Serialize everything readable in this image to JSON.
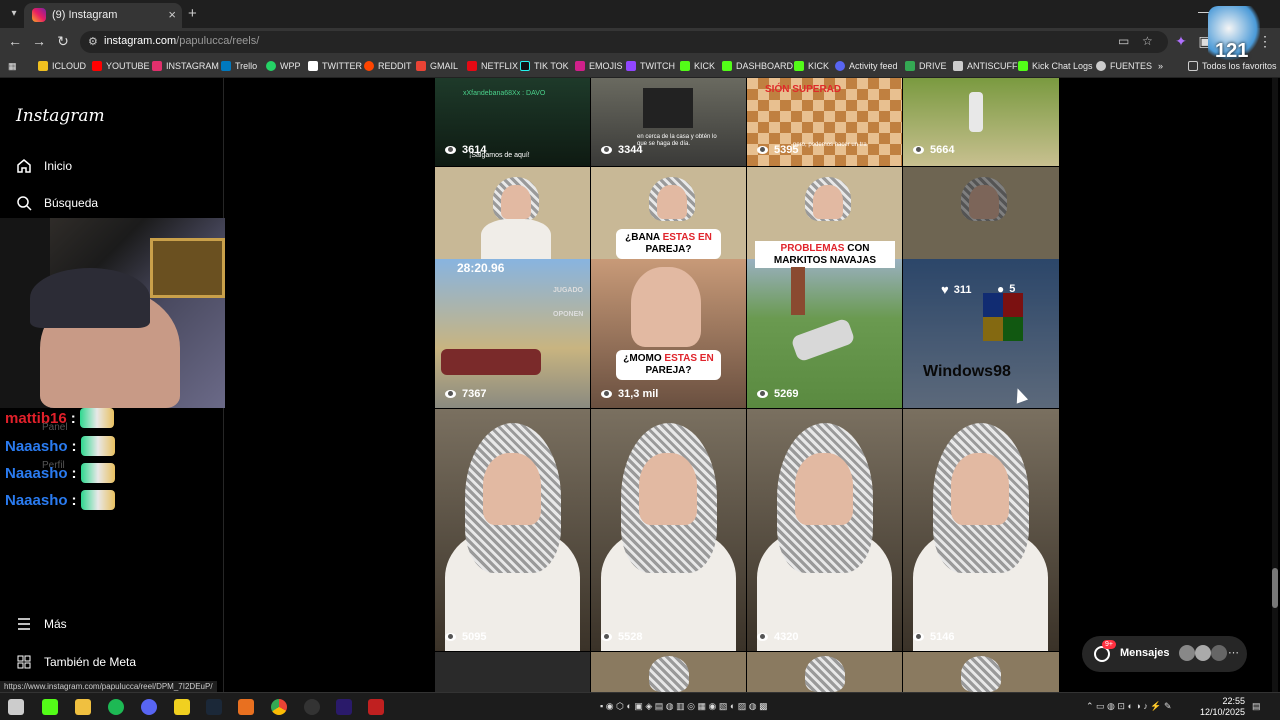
{
  "browser": {
    "tab_title": "(9) Instagram",
    "url_domain": "instagram.com",
    "url_path": "/papulucca/reels/",
    "status_url": "https://www.instagram.com/papulucca/reel/DPM_7I2DEuP/"
  },
  "bookmarks": [
    {
      "label": "ICLOUD",
      "color": "#f0c020"
    },
    {
      "label": "YOUTUBE",
      "color": "#ff0000"
    },
    {
      "label": "INSTAGRAM",
      "color": "#e1306c"
    },
    {
      "label": "Trello",
      "color": "#0079bf"
    },
    {
      "label": "WPP",
      "color": "#25d366"
    },
    {
      "label": "TWITTER",
      "color": "#ffffff"
    },
    {
      "label": "REDDIT",
      "color": "#ff4500"
    },
    {
      "label": "GMAIL",
      "color": "#ea4335"
    },
    {
      "label": "NETFLIX",
      "color": "#e50914"
    },
    {
      "label": "TIK TOK",
      "color": "#000000"
    },
    {
      "label": "EMOJIS",
      "color": "#d0208a"
    },
    {
      "label": "TWITCH",
      "color": "#9146ff"
    },
    {
      "label": "KICK",
      "color": "#53fc18"
    },
    {
      "label": "DASHBOARD",
      "color": "#53fc18"
    },
    {
      "label": "KICK",
      "color": "#53fc18"
    },
    {
      "label": "Activity feed",
      "color": "#5865f2"
    },
    {
      "label": "DRIVE",
      "color": "#34a853"
    },
    {
      "label": "ANTISCUFF",
      "color": "#cccccc"
    },
    {
      "label": "Kick Chat Logs",
      "color": "#53fc18"
    },
    {
      "label": "FUENTES",
      "color": "#cccccc"
    }
  ],
  "bookmarks_overflow": "»",
  "all_bookmarks": "Todos los favoritos",
  "sidebar": {
    "logo": "Instagram",
    "items": {
      "home": "Inicio",
      "search": "Búsqueda",
      "panel": "Panel",
      "profile": "Perfil",
      "more": "Más",
      "meta": "También de Meta"
    }
  },
  "chat": [
    {
      "user": "mattib16",
      "color": "#e0202a"
    },
    {
      "user": "Naaasho",
      "color": "#2a7bf0"
    },
    {
      "user": "Naaasho",
      "color": "#2a7bf0"
    },
    {
      "user": "Naaasho",
      "color": "#2a7bf0"
    }
  ],
  "reels": {
    "row1": [
      "3614",
      "3344",
      "5395",
      "5664"
    ],
    "row1_texts": [
      "xXfandebana68Xx : DAVO",
      "¡Salgamos de aquí!",
      "en cerca de la casa y obtén lo que se haga de día.",
      "SIÓN SUPERAD",
      "pero, podemos hacer un tra"
    ],
    "row2": [
      "7367",
      "31,3 mil",
      "5269"
    ],
    "row2_timer": "28:20.96",
    "row2_hud": [
      "JUGADO",
      "OPONEN"
    ],
    "caption_bana_a": "¿BANA",
    "caption_bana_b": "ESTAS EN",
    "caption_bana_c": "PAREJA?",
    "caption_momo_a": "¿MOMO",
    "caption_momo_b": "ESTAS EN",
    "caption_momo_c": "PAREJA?",
    "caption_problemas_a": "PROBLEMAS",
    "caption_problemas_b": "CON",
    "caption_problemas_c": "MARKITOS NAVAJAS",
    "hover_likes": "311",
    "hover_comments": "5",
    "win98_text": "Windows98",
    "row3": [
      "5095",
      "5528",
      "4320",
      "5146"
    ]
  },
  "messages": {
    "label": "Mensajes",
    "badge": "9+"
  },
  "taskbar": {
    "time": "22:55",
    "date": "12/10/2025"
  },
  "corner_overlay": "121"
}
